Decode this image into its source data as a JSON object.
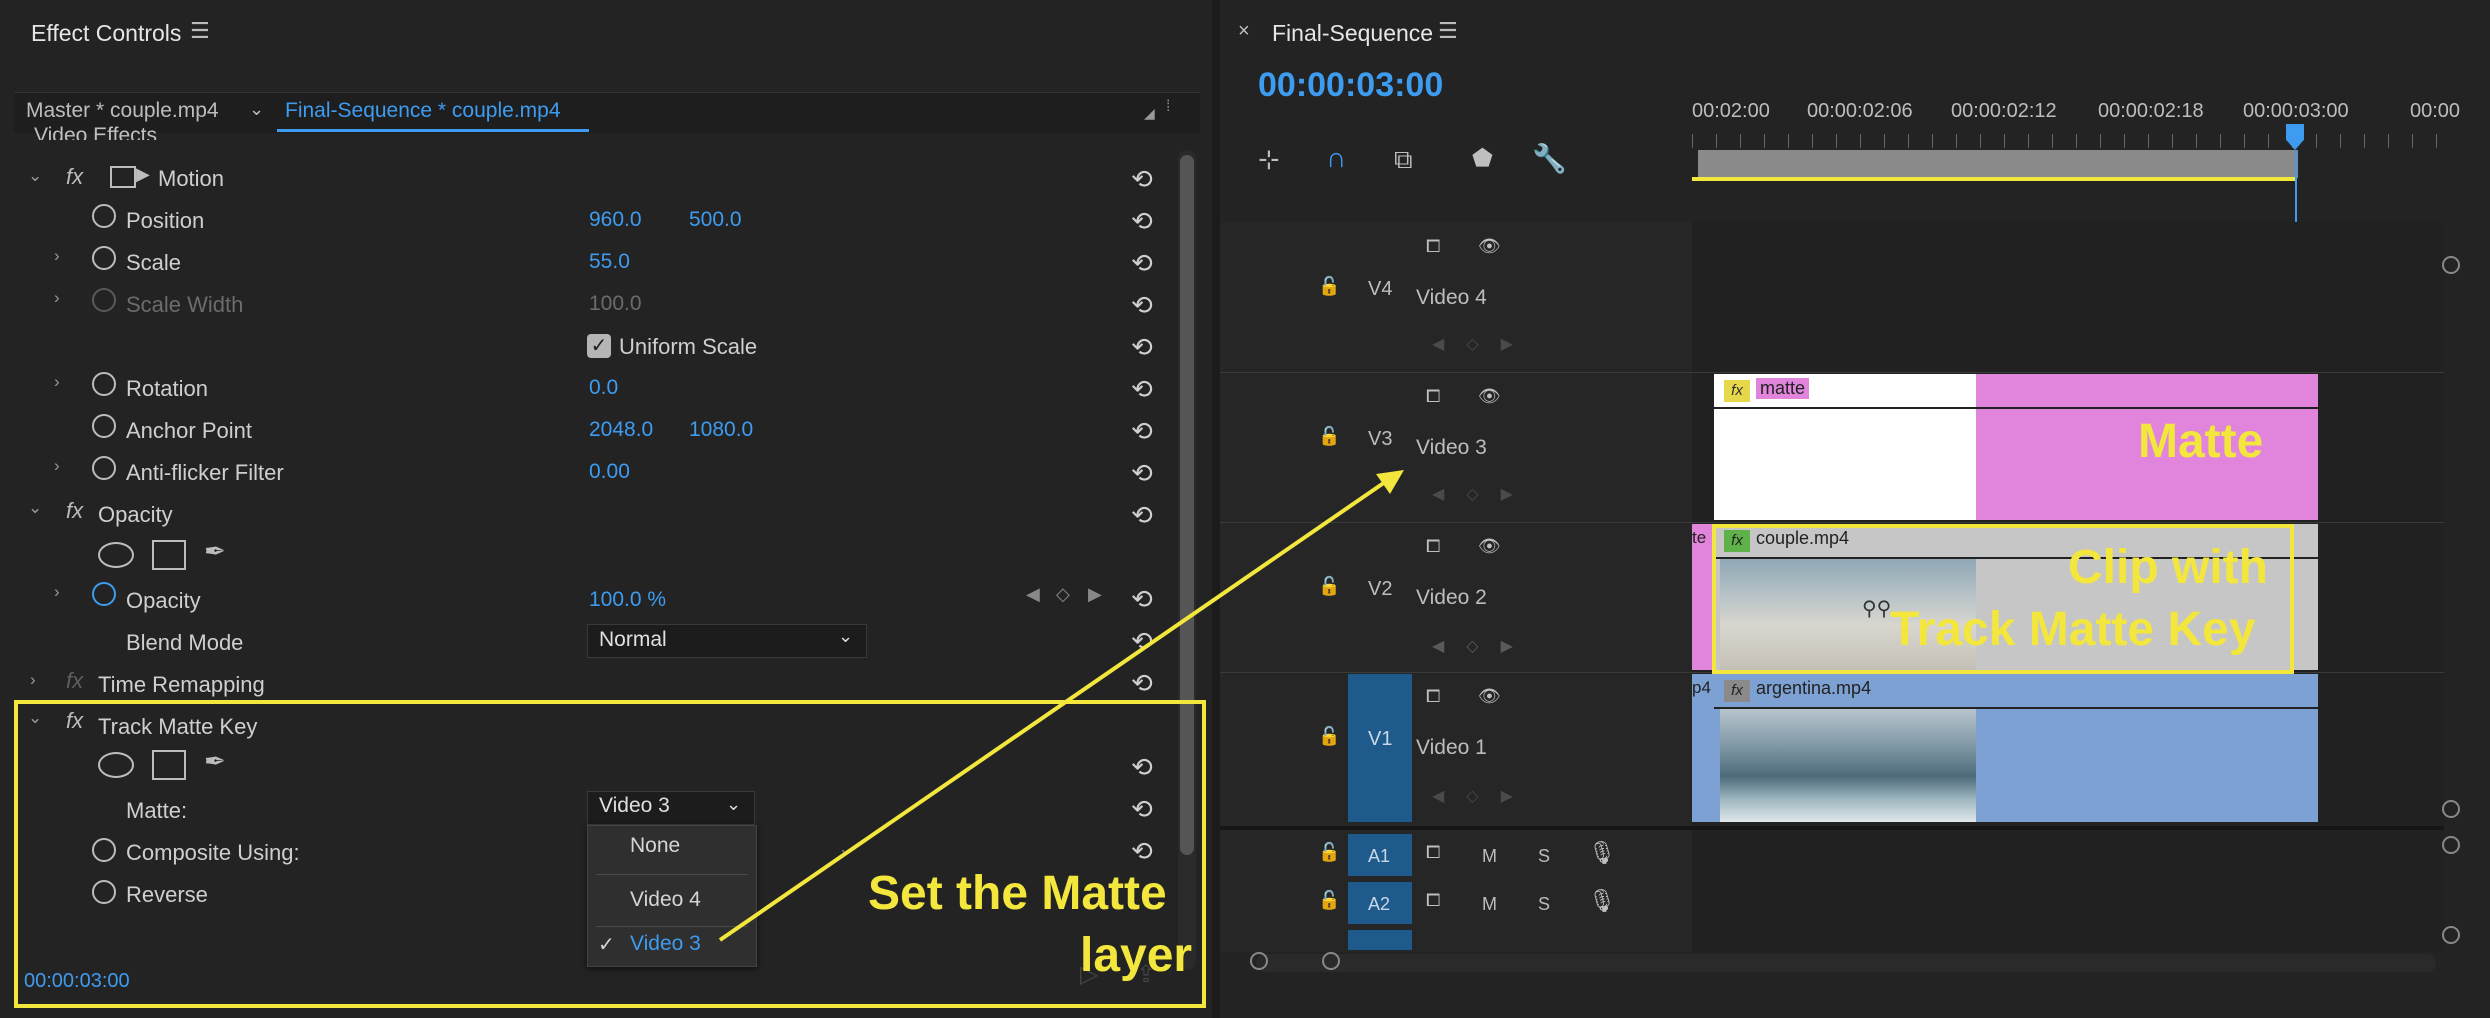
{
  "effect_controls": {
    "title": "Effect Controls",
    "source_tab": "Master * couple.mp4",
    "sequence_tab": "Final-Sequence * couple.mp4",
    "section_header": "Video Effects",
    "motion": {
      "label": "Motion",
      "position": {
        "label": "Position",
        "x": "960.0",
        "y": "500.0"
      },
      "scale": {
        "label": "Scale",
        "value": "55.0"
      },
      "scale_width": {
        "label": "Scale Width",
        "value": "100.0"
      },
      "uniform_scale": {
        "label": "Uniform Scale",
        "checked": true
      },
      "rotation": {
        "label": "Rotation",
        "value": "0.0"
      },
      "anchor_point": {
        "label": "Anchor Point",
        "x": "2048.0",
        "y": "1080.0"
      },
      "anti_flicker": {
        "label": "Anti-flicker Filter",
        "value": "0.00"
      }
    },
    "opacity": {
      "label": "Opacity",
      "opacity_prop": {
        "label": "Opacity",
        "value": "100.0 %"
      },
      "blend_mode": {
        "label": "Blend Mode",
        "value": "Normal"
      }
    },
    "time_remapping": {
      "label": "Time Remapping"
    },
    "track_matte": {
      "label": "Track Matte Key",
      "matte": {
        "label": "Matte:",
        "value": "Video 3"
      },
      "composite_using": {
        "label": "Composite Using:"
      },
      "reverse": {
        "label": "Reverse"
      }
    },
    "dropdown_options": [
      "None",
      "Video 4",
      "Video 3"
    ],
    "dropdown_selected": "Video 3",
    "timecode": "00:00:03:00"
  },
  "timeline": {
    "title": "Final-Sequence",
    "timecode": "00:00:03:00",
    "ruler_labels": [
      "00:02:00",
      "00:00:02:06",
      "00:00:02:12",
      "00:00:02:18",
      "00:00:03:00",
      "00:00"
    ],
    "tracks": [
      {
        "id": "V4",
        "name": "Video 4"
      },
      {
        "id": "V3",
        "name": "Video 3"
      },
      {
        "id": "V2",
        "name": "Video 2"
      },
      {
        "id": "V1",
        "name": "Video 1"
      }
    ],
    "audio_tracks": [
      {
        "id": "A1",
        "m": "M",
        "s": "S"
      },
      {
        "id": "A2",
        "m": "M",
        "s": "S"
      }
    ],
    "clips": {
      "matte": "matte",
      "couple": "couple.mp4",
      "couple_prefix": "te",
      "argentina": "argentina.mp4",
      "argentina_prefix": "p4",
      "fx": "fx"
    }
  },
  "annotations": {
    "matte": "Matte",
    "clip_line1": "Clip with",
    "clip_line2": "Track Matte Key",
    "set_line1": "Set the Matte",
    "set_line2": "layer"
  },
  "colors": {
    "accent_blue": "#3d9cf0",
    "annotation_yellow": "#f3e63c",
    "matte_pink": "#e184dc",
    "v1_blue": "#7da1d2"
  }
}
